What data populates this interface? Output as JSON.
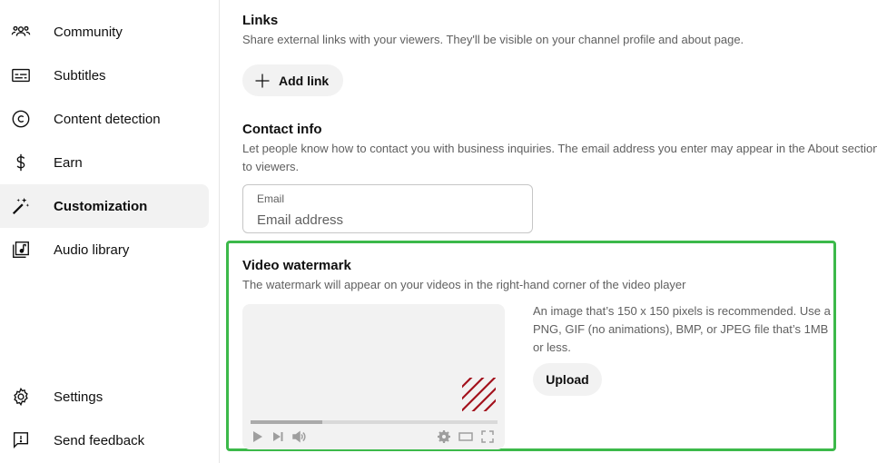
{
  "sidebar": {
    "items": [
      {
        "label": "Community",
        "icon": "community-icon",
        "active": false
      },
      {
        "label": "Subtitles",
        "icon": "subtitles-icon",
        "active": false
      },
      {
        "label": "Content detection",
        "icon": "copyright-icon",
        "active": false
      },
      {
        "label": "Earn",
        "icon": "dollar-icon",
        "active": false
      },
      {
        "label": "Customization",
        "icon": "magic-wand-icon",
        "active": true
      },
      {
        "label": "Audio library",
        "icon": "audio-library-icon",
        "active": false
      }
    ],
    "bottom_items": [
      {
        "label": "Settings",
        "icon": "gear-icon"
      },
      {
        "label": "Send feedback",
        "icon": "feedback-icon"
      }
    ]
  },
  "links": {
    "title": "Links",
    "description": "Share external links with your viewers. They'll be visible on your channel profile and about page.",
    "add_link_label": "Add link"
  },
  "contact": {
    "title": "Contact info",
    "description_line1": "Let people know how to contact you with business inquiries. The email address you enter may appear in the About section",
    "description_line2": "to viewers.",
    "email_label": "Email",
    "email_placeholder": "Email address",
    "email_value": ""
  },
  "watermark": {
    "title": "Video watermark",
    "description": "The watermark will appear on your videos in the right-hand corner of the video player",
    "help_text": "An image that’s 150 x 150 pixels is recommended. Use a PNG, GIF (no animations), BMP, or JPEG file that’s 1MB or less.",
    "upload_label": "Upload",
    "player_progress": 0.29,
    "highlight_color": "#3cb94a",
    "placeholder_stripe_color": "#a3111c"
  }
}
